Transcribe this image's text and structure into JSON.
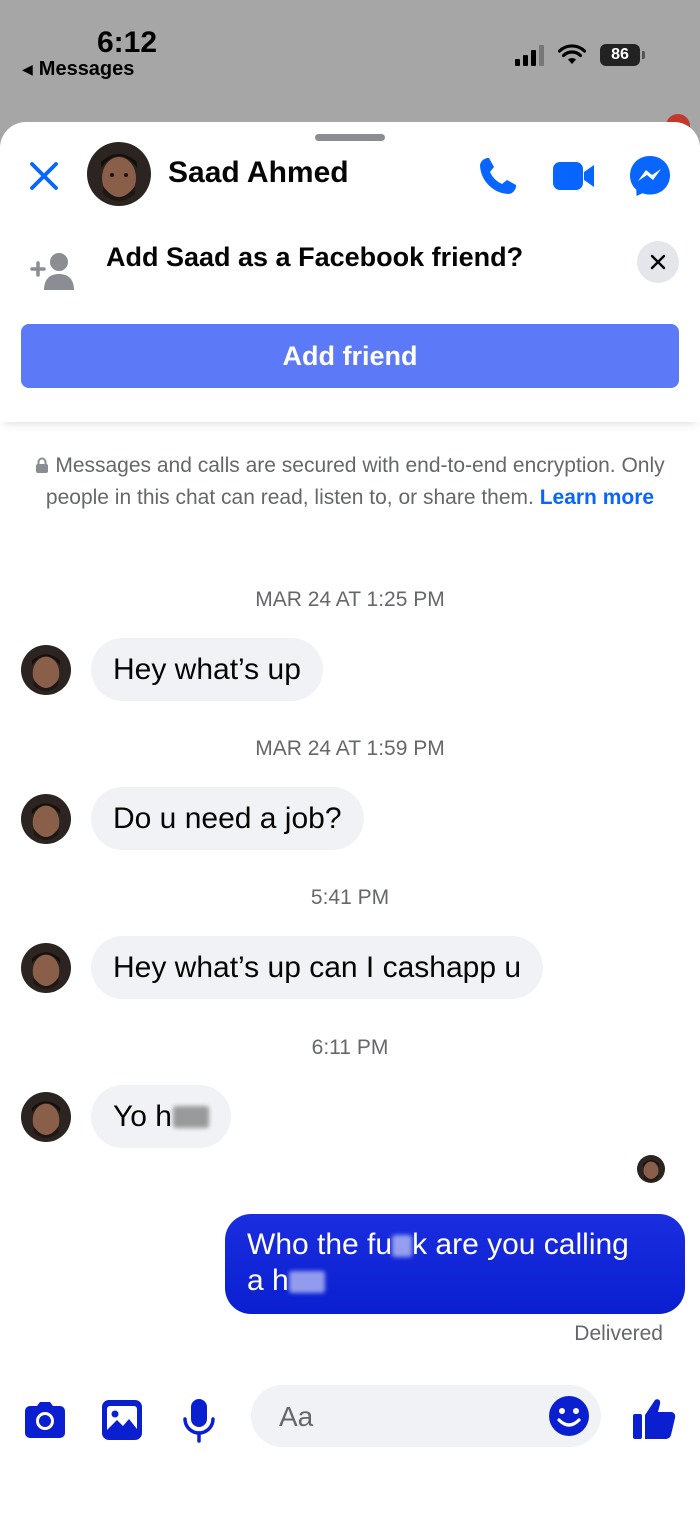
{
  "status_bar": {
    "time": "6:12",
    "back_app": "Messages",
    "battery": "86"
  },
  "chat_header": {
    "contact_name": "Saad Ahmed",
    "icons": [
      "close-icon",
      "phone-icon",
      "video-camera-icon",
      "messenger-icon"
    ]
  },
  "friend_banner": {
    "question": "Add Saad as a Facebook friend?",
    "button_label": "Add friend"
  },
  "encryption_notice": {
    "text": "Messages and calls are secured with end-to-end encryption. Only people in this chat can read, listen to, or share them.",
    "link": "Learn more"
  },
  "conversation": [
    {
      "timestamp": "MAR 24 AT 1:25 PM",
      "message": "Hey what’s up"
    },
    {
      "timestamp": "MAR 24 AT 1:59 PM",
      "message": "Do u need a job?"
    },
    {
      "timestamp": "5:41 PM",
      "message": "Hey what’s up can I cashapp u"
    },
    {
      "timestamp": "6:11 PM",
      "message_visible": "Yo h"
    }
  ],
  "outgoing": {
    "part1": "Who the fu",
    "part2": "k are you calling",
    "part3": "a h",
    "status": "Delivered"
  },
  "composer": {
    "placeholder": "Aa",
    "tools": [
      "camera-icon",
      "gallery-icon",
      "microphone-icon",
      "emoji-icon",
      "thumbs-up-icon"
    ]
  },
  "colors": {
    "accent": "#0866ff",
    "add_friend_button": "#5c79f7",
    "outgoing_bubble": "#0a1fd0",
    "incoming_bubble": "#f0f2f5"
  }
}
